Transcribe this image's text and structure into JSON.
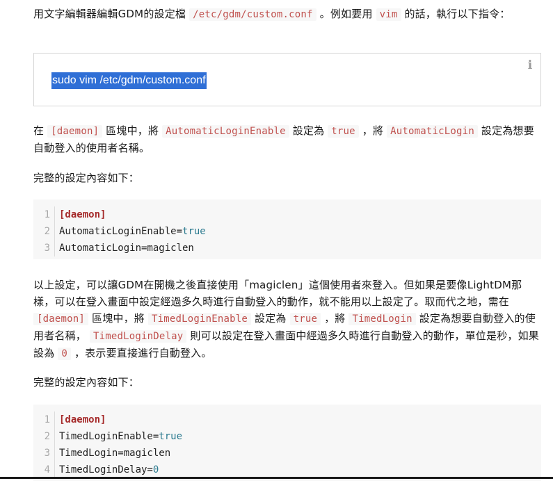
{
  "p1": {
    "a": "用文字編輯器編輯GDM的設定檔",
    "code1": "/etc/gdm/custom.conf",
    "b": "。例如要用",
    "code2": "vim",
    "c": "的話，執行以下指令："
  },
  "command": {
    "text": "sudo vim /etc/gdm/custom.conf",
    "info_icon": "info-icon"
  },
  "p2": {
    "a": "在",
    "code1": "[daemon]",
    "b": "區塊中，將",
    "code2": "AutomaticLoginEnable",
    "c": "設定為",
    "code3": "true",
    "d": "，將",
    "code4": "AutomaticLogin",
    "e": "設定為想要自動登入的使用者名稱。"
  },
  "p3": "完整的設定內容如下：",
  "code_block1": {
    "lines": [
      {
        "num": "1",
        "section": "[daemon]"
      },
      {
        "num": "2",
        "key": "AutomaticLoginEnable=",
        "value": "true"
      },
      {
        "num": "3",
        "key": "AutomaticLogin=magiclen"
      }
    ]
  },
  "p4": {
    "a": "以上設定，可以讓GDM在開機之後直接使用「magiclen」這個使用者來登入。但如果是要像LightDM那樣，可以在登入畫面中設定經過多久時進行自動登入的動作，就不能用以上設定了。取而代之地，需在",
    "code1": "[daemon]",
    "b": "區塊中，將",
    "code2": "TimedLoginEnable",
    "c": "設定為",
    "code3": "true",
    "d": "，將",
    "code4": "TimedLogin",
    "e": "設定為想要自動登入的使用者名稱，",
    "code5": "TimedLoginDelay",
    "f": "則可以設定在登入畫面中經過多久時進行自動登入的動作，單位是秒，如果設為",
    "code6": "0",
    "g": "，表示要直接進行自動登入。"
  },
  "p5": "完整的設定內容如下：",
  "code_block2": {
    "lines": [
      {
        "num": "1",
        "section": "[daemon]"
      },
      {
        "num": "2",
        "key": "TimedLoginEnable=",
        "value": "true"
      },
      {
        "num": "3",
        "key": "TimedLogin=magiclen"
      },
      {
        "num": "4",
        "key": "TimedLoginDelay=",
        "value": "0"
      }
    ]
  }
}
